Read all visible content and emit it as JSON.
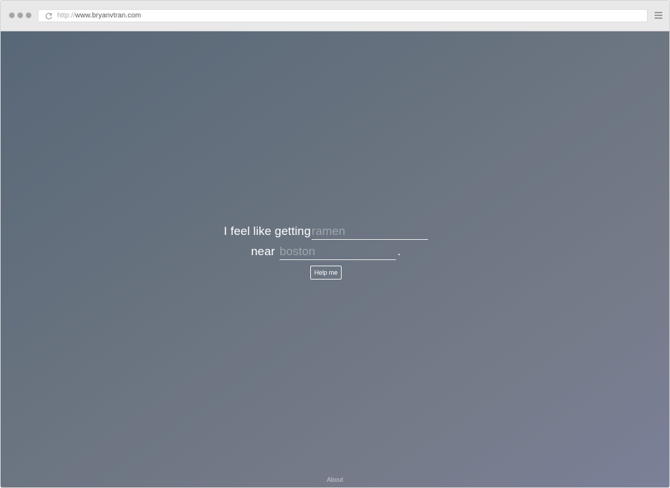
{
  "browser": {
    "url_scheme": "http://",
    "url_host": "www.bryanvtran.com",
    "reload_icon": "reload-icon",
    "menu_icon": "hamburger-menu-icon"
  },
  "form": {
    "line1_text": "I feel like getting",
    "food_placeholder": "ramen",
    "line2_text": "near",
    "location_placeholder": "boston",
    "period": ".",
    "submit_label": "Help me"
  },
  "footer": {
    "about_label": "About"
  },
  "colors": {
    "background_top_left": "#586777",
    "background_bottom_right": "#7a8098",
    "text": "#ffffff"
  }
}
